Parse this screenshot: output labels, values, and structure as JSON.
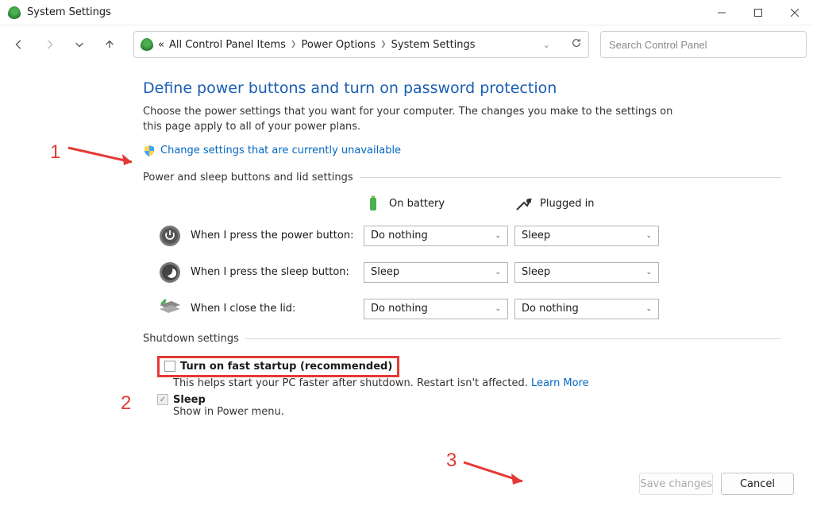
{
  "window": {
    "title": "System Settings"
  },
  "breadcrumb": {
    "prefix": "«",
    "items": [
      "All Control Panel Items",
      "Power Options",
      "System Settings"
    ]
  },
  "search": {
    "placeholder": "Search Control Panel"
  },
  "page": {
    "title": "Define power buttons and turn on password protection",
    "description": "Choose the power settings that you want for your computer. The changes you make to the settings on this page apply to all of your power plans.",
    "admin_link": "Change settings that are currently unavailable"
  },
  "section1": {
    "heading": "Power and sleep buttons and lid settings",
    "col_battery": "On battery",
    "col_plugged": "Plugged in",
    "rows": [
      {
        "label": "When I press the power button:",
        "battery": "Do nothing",
        "plugged": "Sleep"
      },
      {
        "label": "When I press the sleep button:",
        "battery": "Sleep",
        "plugged": "Sleep"
      },
      {
        "label": "When I close the lid:",
        "battery": "Do nothing",
        "plugged": "Do nothing"
      }
    ]
  },
  "section2": {
    "heading": "Shutdown settings",
    "fast_startup_label": "Turn on fast startup (recommended)",
    "fast_startup_desc": "This helps start your PC faster after shutdown. Restart isn't affected. ",
    "learn_more": "Learn More",
    "sleep_label": "Sleep",
    "sleep_desc": "Show in Power menu."
  },
  "buttons": {
    "save": "Save changes",
    "cancel": "Cancel"
  },
  "annotations": {
    "one": "1",
    "two": "2",
    "three": "3"
  }
}
